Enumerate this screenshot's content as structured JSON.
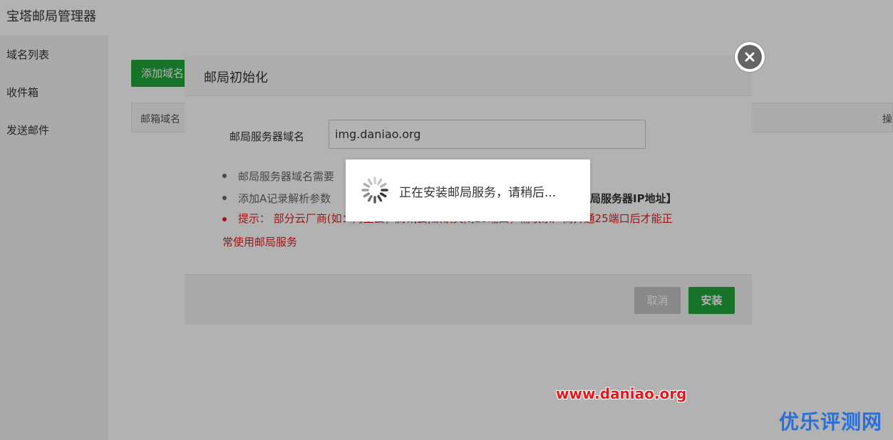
{
  "app": {
    "title": "宝塔邮局管理器",
    "sidebar": [
      {
        "label": "域名列表"
      },
      {
        "label": "收件箱"
      },
      {
        "label": "发送邮件"
      }
    ],
    "add_domain_button": "添加域名",
    "table_headers": {
      "domain": "邮箱域名",
      "ops": "操"
    }
  },
  "dialog": {
    "title": "邮局初始化",
    "field_label": "邮局服务器域名",
    "field_value": "img.daniao.org",
    "tips": [
      "邮局服务器域名需要",
      "添加A记录解析参数"
    ],
    "tip_tail": "邮局服务器IP地址】",
    "warning_line1": "提示：  部分云厂商(如：阿里云，腾讯云)默认关闭25端口，需联系厂商开通25端口后才能正",
    "warning_line2": "常使用邮局服务",
    "cancel_label": "取消",
    "install_label": "安装"
  },
  "loading": {
    "text": "正在安装邮局服务，请稍后..."
  },
  "watermarks": {
    "url": "www.daniao.org",
    "site": "优乐评测网"
  },
  "colors": {
    "accent_green": "#20a53a",
    "warning_red": "#e02020",
    "watermark_blue": "#2a6fd6"
  }
}
